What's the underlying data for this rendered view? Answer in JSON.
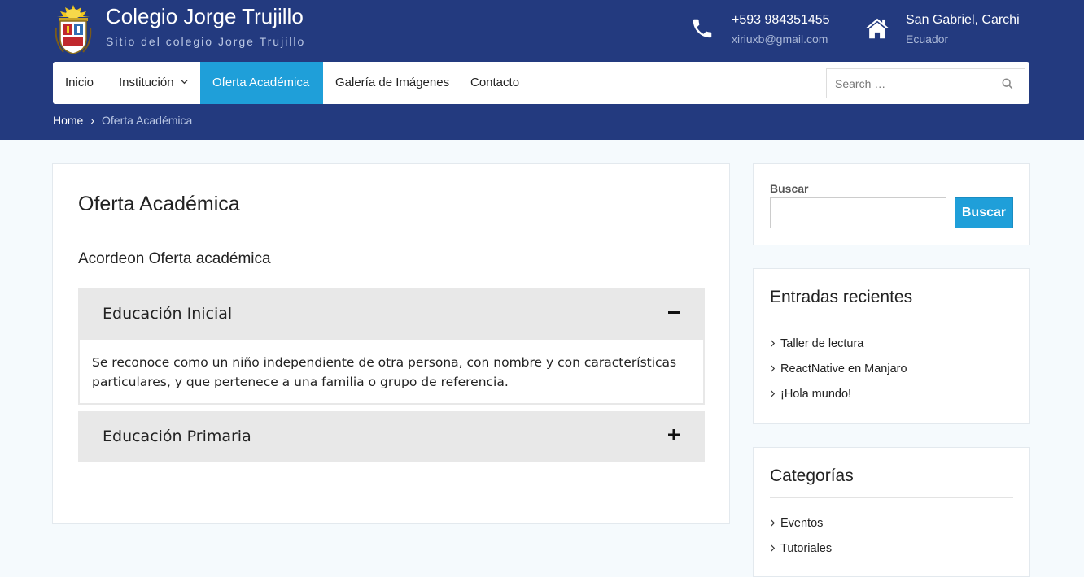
{
  "site": {
    "title": "Colegio Jorge Trujillo",
    "tagline": "Sitio del colegio Jorge Trujillo"
  },
  "contact": {
    "phone": "+593 984351455",
    "email": "xiriuxb@gmail.com",
    "city": "San Gabriel, Carchi",
    "country": "Ecuador"
  },
  "nav": {
    "items": [
      {
        "label": "Inicio"
      },
      {
        "label": "Institución"
      },
      {
        "label": "Oferta Académica"
      },
      {
        "label": "Galería de Imágenes"
      },
      {
        "label": "Contacto"
      }
    ],
    "search_placeholder": "Search …"
  },
  "breadcrumb": {
    "home": "Home",
    "separator": "›",
    "current": "Oferta Académica"
  },
  "main": {
    "title": "Oferta Académica",
    "accordion_heading": "Acordeon Oferta académica",
    "accordion": [
      {
        "title": "Educación Inicial",
        "expanded": true,
        "content": "Se reconoce como un niño independiente de otra persona, con nombre y con características particulares, y que pertenece a una familia o grupo de referencia."
      },
      {
        "title": "Educación Primaria",
        "expanded": false
      }
    ]
  },
  "sidebar": {
    "search": {
      "label": "Buscar",
      "button": "Buscar"
    },
    "recent": {
      "title": "Entradas recientes",
      "items": [
        "Taller de lectura",
        "ReactNative en Manjaro",
        "¡Hola mundo!"
      ]
    },
    "categories": {
      "title": "Categorías",
      "items": [
        "Eventos",
        "Tutoriales"
      ]
    }
  },
  "colors": {
    "header_bg": "#233a7f",
    "accent": "#1f9fd9",
    "page_bg": "#f5fafd"
  }
}
